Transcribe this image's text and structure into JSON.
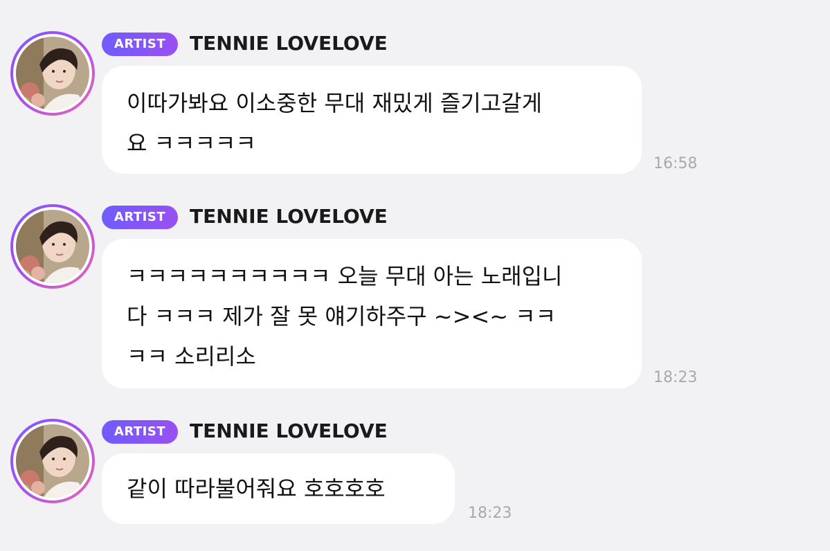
{
  "messages": [
    {
      "badge": "ARTIST",
      "sender": "TENNIE LOVELOVE",
      "text": "이따가봐요 이소중한 무대 재밌게 즐기고갈게\n요 ㅋㅋㅋㅋㅋ",
      "time": "16:58"
    },
    {
      "badge": "ARTIST",
      "sender": "TENNIE LOVELOVE",
      "text": "ㅋㅋㅋㅋㅋㅋㅋㅋㅋㅋ 오늘 무대 아는 노래입니\n다 ㅋㅋㅋ 제가 잘 못 얘기하주구 ~><~ ㅋㅋ\nㅋㅋ 소리리소",
      "time": "18:23"
    },
    {
      "badge": "ARTIST",
      "sender": "TENNIE LOVELOVE",
      "text": "같이 따라불어줘요 호호호호",
      "time": "18:23"
    }
  ],
  "colors": {
    "background": "#f2f2f4",
    "bubble": "#ffffff",
    "badge_gradient_start": "#6f5cff",
    "badge_gradient_end": "#9a4ff2",
    "timestamp": "#a8a8ad"
  },
  "icons": {
    "avatar": "profile-photo-avatar"
  }
}
